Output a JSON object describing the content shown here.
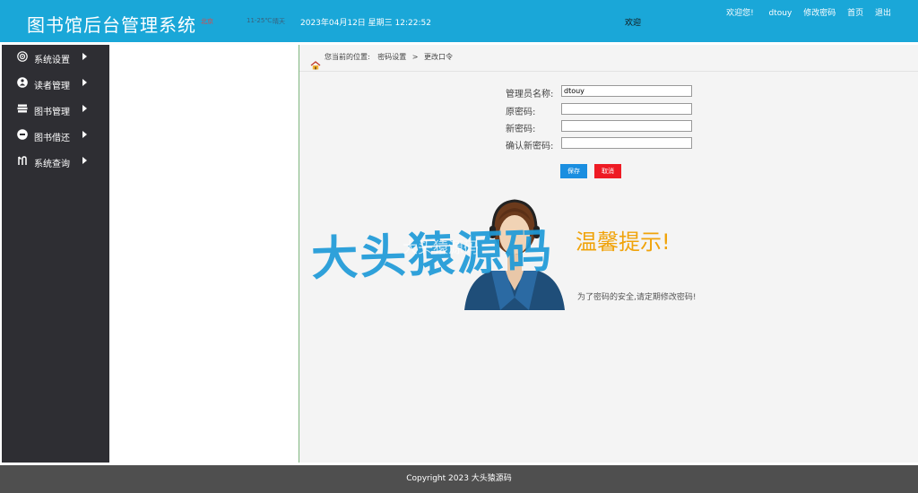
{
  "header": {
    "title": "图书馆后台管理系统",
    "weather_city": "北京",
    "weather_temp": "11-25℃",
    "weather_desc": "晴天",
    "datetime": "2023年04月12日 星期三 12:22:52",
    "ticker": "欢迎",
    "nav": {
      "welcome": "欢迎您!",
      "username": "dtouy",
      "change_password": "修改密码",
      "home": "首页",
      "logout": "退出"
    }
  },
  "sidebar": {
    "items": [
      {
        "label": "系统设置",
        "icon": "settings-icon"
      },
      {
        "label": "读者管理",
        "icon": "reader-icon"
      },
      {
        "label": "图书管理",
        "icon": "books-icon"
      },
      {
        "label": "图书借还",
        "icon": "borrow-icon"
      },
      {
        "label": "系统查询",
        "icon": "query-icon"
      }
    ]
  },
  "breadcrumb": {
    "prefix": "您当前的位置:",
    "level1": "密码设置",
    "separator": ">",
    "level2": "更改口令"
  },
  "form": {
    "admin_name_label": "管理员名称:",
    "admin_name_value": "dtouy",
    "old_password_label": "原密码:",
    "new_password_label": "新密码:",
    "confirm_password_label": "确认新密码:",
    "save_label": "保存",
    "cancel_label": "取消"
  },
  "tip": {
    "title": "温馨提示!",
    "text": "为了密码的安全,请定期修改密码!"
  },
  "watermark": {
    "text": "大头猿源码",
    "faint_text": "大头猿源码"
  },
  "footer": {
    "copyright": "Copyright 2023 大头猿源码"
  },
  "colors": {
    "header_bg": "#1aa7d8",
    "sidebar_bg": "#2e2e33",
    "save_button": "#1a8ee0",
    "cancel_button": "#ee1b24",
    "tip_title": "#f0a30a",
    "footer_bg": "#4f4f4f"
  }
}
